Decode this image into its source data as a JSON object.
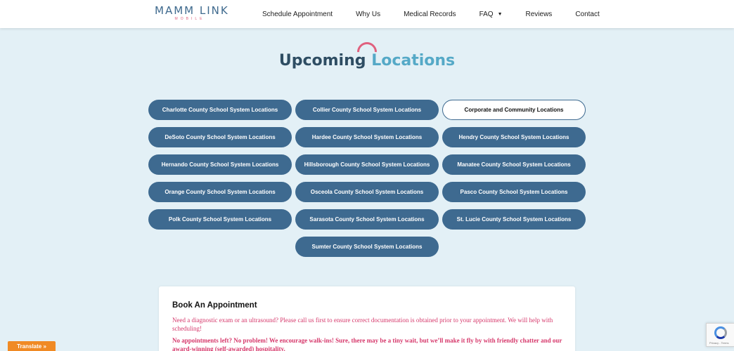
{
  "header": {
    "logo_main": "MAMM LINK",
    "logo_sub": "MOBILE",
    "nav": [
      {
        "label": "Schedule Appointment"
      },
      {
        "label": "Why Us"
      },
      {
        "label": "Medical Records"
      },
      {
        "label": "FAQ",
        "has_dropdown": true
      },
      {
        "label": "Reviews"
      },
      {
        "label": "Contact"
      }
    ]
  },
  "title": {
    "part1": "Upcoming",
    "part2": "Locations"
  },
  "locations": [
    {
      "label": "Charlotte County School System Locations",
      "active": false
    },
    {
      "label": "Collier County School System Locations",
      "active": false
    },
    {
      "label": "Corporate and Community Locations",
      "active": true
    },
    {
      "label": "DeSoto County School System Locations",
      "active": false
    },
    {
      "label": "Hardee County School System Locations",
      "active": false
    },
    {
      "label": "Hendry County School System Locations",
      "active": false
    },
    {
      "label": "Hernando County School System Locations",
      "active": false
    },
    {
      "label": "Hillsborough County School System Locations",
      "active": false
    },
    {
      "label": "Manatee County School System Locations",
      "active": false
    },
    {
      "label": "Orange County School System Locations",
      "active": false
    },
    {
      "label": "Osceola County School System Locations",
      "active": false
    },
    {
      "label": "Pasco County School System Locations",
      "active": false
    },
    {
      "label": "Polk County School System Locations",
      "active": false
    },
    {
      "label": "Sarasota County School System Locations",
      "active": false
    },
    {
      "label": "St. Lucie County School System Locations",
      "active": false
    },
    {
      "label": "Sumter County School System Locations",
      "active": false
    }
  ],
  "booking": {
    "title": "Book An Appointment",
    "text1": "Need a diagnostic exam or an ultrasound? Please call us first to ensure correct documentation is obtained prior to your appointment. We will help with scheduling!",
    "text2": "No appointments left? No problem! We encourage walk-ins! Sure, there may be a tiny wait, but we’ll make it fly by with friendly chatter and our award-winning (self-awarded) hospitality."
  },
  "translate_label": "Translate »",
  "recaptcha_text": "Privacy - Terms",
  "colors": {
    "brand_blue": "#3e6a90",
    "accent_teal": "#55a9c7",
    "accent_pink": "#e0607e",
    "background": "#e3f0f6"
  }
}
